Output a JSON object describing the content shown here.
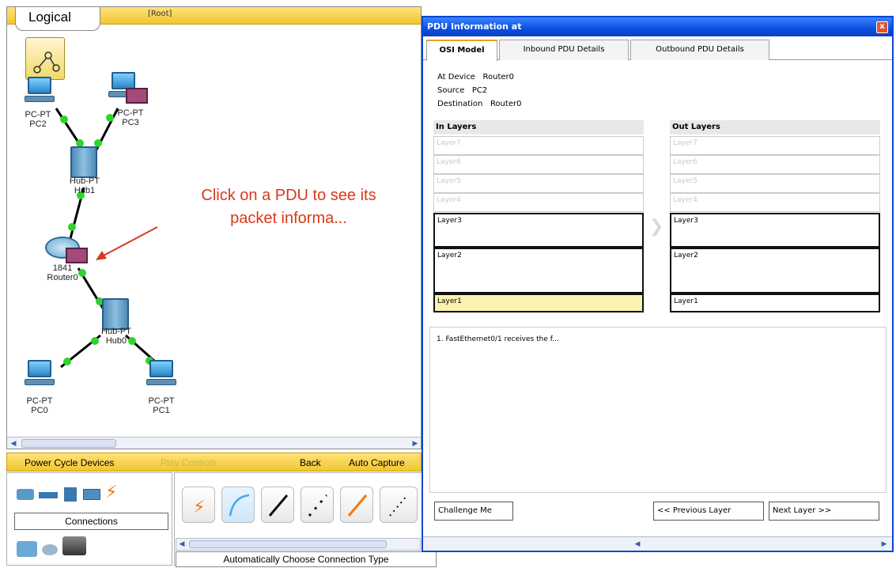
{
  "workspace": {
    "tab_label": "Logical",
    "root_label": "[Root]",
    "callout_line1": "Click on a PDU to see its",
    "callout_line2": "packet informa...",
    "devices": {
      "pc2": {
        "type": "PC-PT",
        "name": "PC2"
      },
      "pc3": {
        "type": "PC-PT",
        "name": "PC3"
      },
      "hub1": {
        "type": "Hub-PT",
        "name": "Hub1"
      },
      "router0": {
        "type": "1841",
        "name": "Router0"
      },
      "hub0": {
        "type": "Hub-PT",
        "name": "Hub0"
      },
      "pc0": {
        "type": "PC-PT",
        "name": "PC0"
      },
      "pc1": {
        "type": "PC-PT",
        "name": "PC1"
      }
    }
  },
  "bottom_bar": {
    "power_cycle": "Power Cycle Devices",
    "play_controls": "Play Controls",
    "back": "Back",
    "auto_capture": "Auto Capture"
  },
  "palette": {
    "connections_label": "Connections",
    "connection_type": "Automatically Choose Connection Type"
  },
  "pdu": {
    "title": "PDU Information at",
    "close": "x",
    "tabs": [
      "OSI Model",
      "Inbound PDU Details",
      "Outbound PDU Details"
    ],
    "at_device_label": "At Device",
    "at_device_value": "Router0",
    "source_label": "Source",
    "source_value": "PC2",
    "destination_label": "Destination",
    "destination_value": "Router0",
    "in_layers": {
      "header": "In Layers",
      "dim": [
        "Layer7",
        "Layer6",
        "Layer5",
        "Layer4"
      ],
      "layer3": "Layer3",
      "layer2": "Layer2",
      "layer1": "Layer1"
    },
    "out_layers": {
      "header": "Out Layers",
      "dim": [
        "Layer7",
        "Layer6",
        "Layer5",
        "Layer4"
      ],
      "layer3": "Layer3",
      "layer2": "Layer2",
      "layer1": "Layer1"
    },
    "detail_text": "1. FastEthernet0/1 receives the f...",
    "challenge_button": "Challenge Me",
    "previous_button": "<< Previous Layer",
    "next_button": "Next Layer >>"
  },
  "colors": {
    "accent_yellow": "#f2c630",
    "titlebar_blue": "#0b50e0",
    "callout_red": "#d73a1c",
    "link_green": "#2dd42d",
    "highlight_layer": "#fbf2b0"
  }
}
